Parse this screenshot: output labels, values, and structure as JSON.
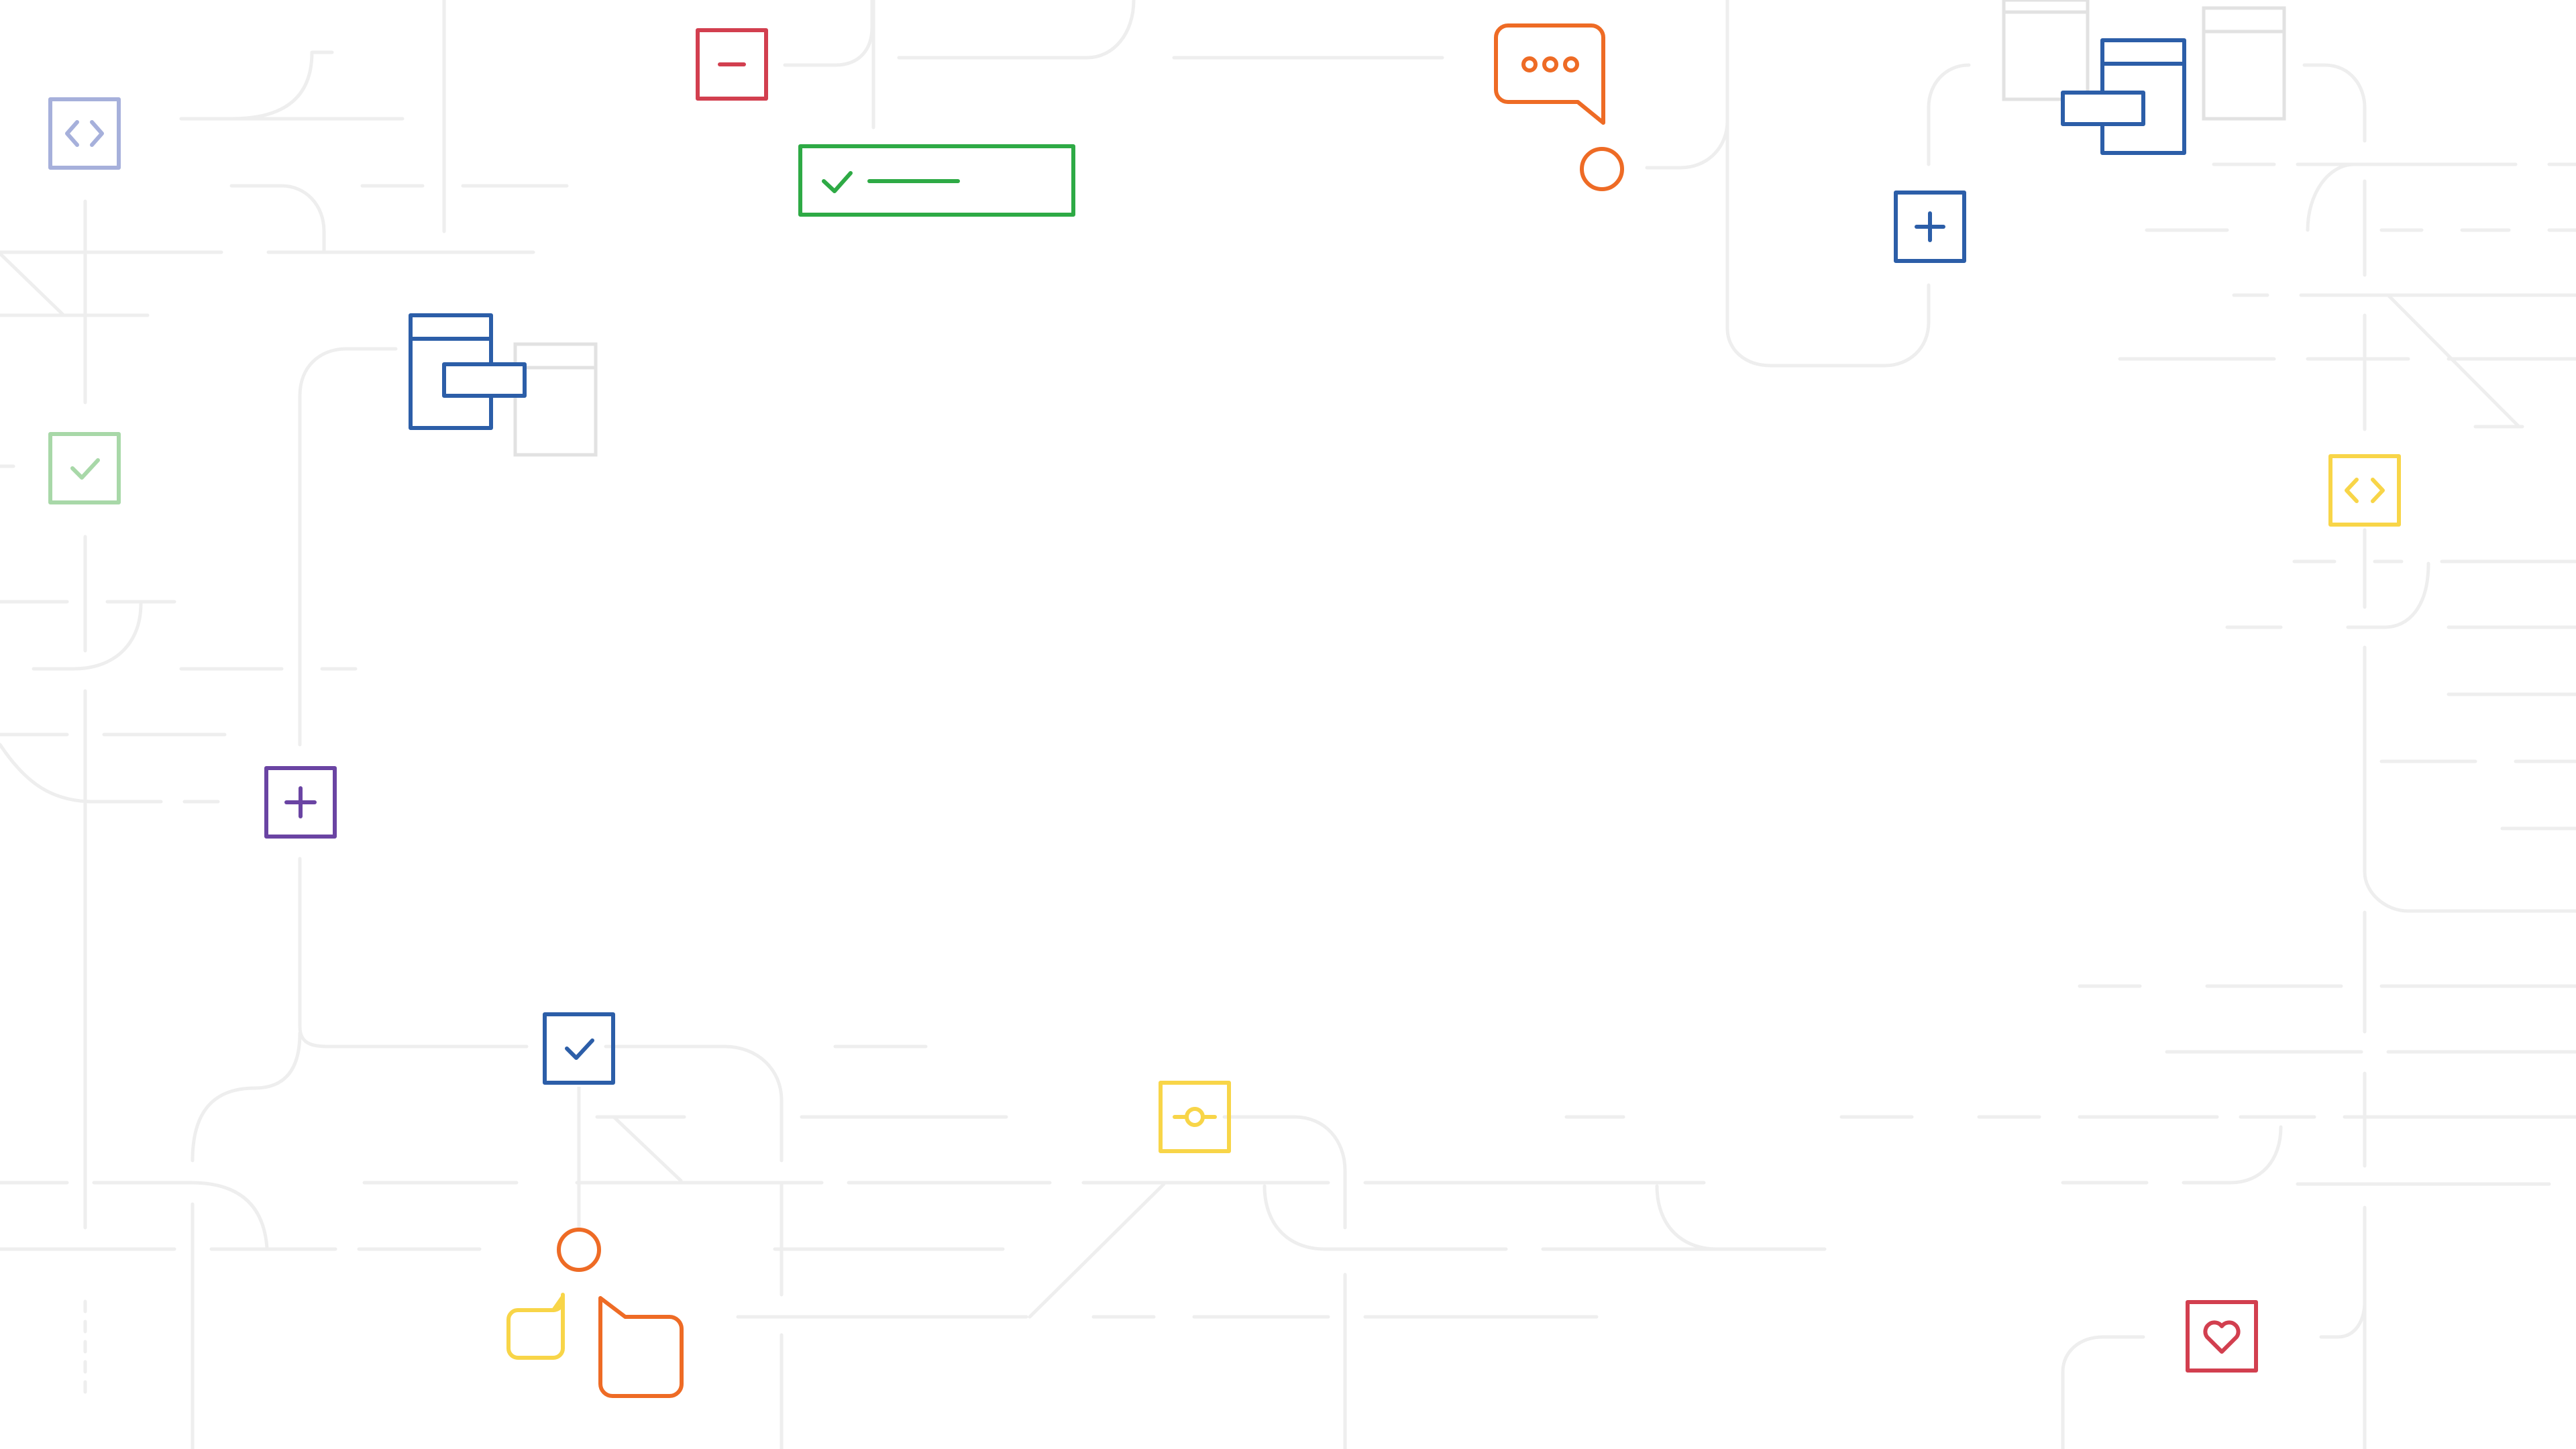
{
  "colors": {
    "background": "#ffffff",
    "circuit": "#eeeeee",
    "red": "#d23f4f",
    "green": "#2eaa45",
    "blue": "#2c5ea8",
    "orange": "#ee6b25",
    "yellow": "#f8d548",
    "purple": "#6a44a3",
    "lavender": "#a6b0db",
    "light_green": "#a8d8a8",
    "light_gray": "#e2e2e2"
  },
  "icons": [
    {
      "name": "code-brackets-icon",
      "color": "lavender"
    },
    {
      "name": "minus-icon",
      "color": "red"
    },
    {
      "name": "checklist-bar-icon",
      "color": "green"
    },
    {
      "name": "chat-bubble-ellipsis-icon",
      "color": "orange"
    },
    {
      "name": "plus-icon",
      "color": "blue"
    },
    {
      "name": "window-stack-icon",
      "color": "blue"
    },
    {
      "name": "window-stack-icon",
      "color": "blue"
    },
    {
      "name": "checkbox-icon",
      "color": "light_green"
    },
    {
      "name": "code-brackets-icon",
      "color": "yellow"
    },
    {
      "name": "plus-icon",
      "color": "purple"
    },
    {
      "name": "checkbox-icon",
      "color": "blue"
    },
    {
      "name": "commit-node-icon",
      "color": "yellow"
    },
    {
      "name": "chat-bubbles-icon",
      "color": "orange"
    },
    {
      "name": "heart-icon",
      "color": "red"
    }
  ]
}
